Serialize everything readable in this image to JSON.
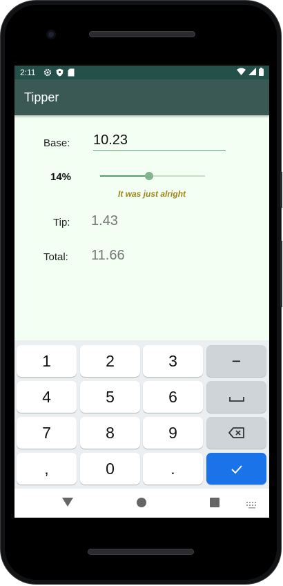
{
  "status_bar": {
    "time": "2:11"
  },
  "app": {
    "title": "Tipper"
  },
  "form": {
    "base_label": "Base:",
    "base_value": "10.23",
    "tip_percent_label": "14%",
    "tip_percent": 14,
    "tip_review": "It was just alright",
    "tip_label": "Tip:",
    "tip_value": "1.43",
    "total_label": "Total:",
    "total_value": "11.66"
  },
  "keyboard": {
    "keys": [
      "1",
      "2",
      "3",
      "−",
      "4",
      "5",
      "6",
      "␣",
      "7",
      "8",
      "9",
      "⌫",
      ",",
      "0",
      ".",
      "✓"
    ],
    "icons": {
      "space": "space-icon",
      "backspace": "backspace-icon",
      "done": "check-icon"
    }
  },
  "colors": {
    "status_bar": "#25504a",
    "app_bar": "#3a5854",
    "background": "#f2fff2",
    "accent": "#5a9a70",
    "review_text": "#9a8614",
    "done_key": "#1a73e8"
  }
}
